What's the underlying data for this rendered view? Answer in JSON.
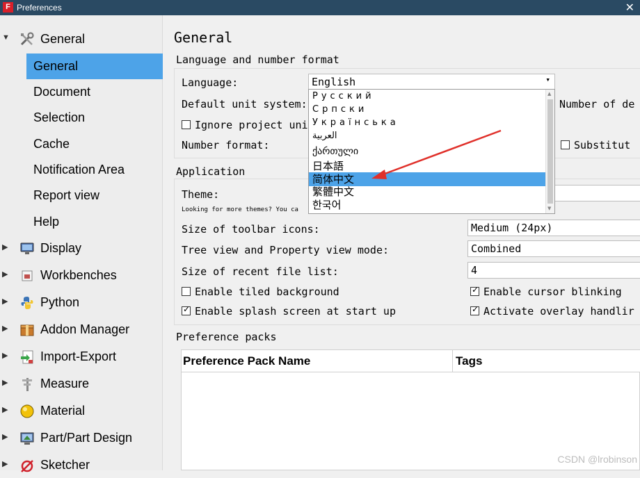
{
  "window": {
    "title": "Preferences",
    "close": "✕"
  },
  "sidebar": {
    "items": [
      {
        "label": "General",
        "expanded": true,
        "icon": "wrench-screwdriver-icon"
      },
      {
        "label": "General",
        "child": true,
        "selected": true
      },
      {
        "label": "Document",
        "child": true
      },
      {
        "label": "Selection",
        "child": true
      },
      {
        "label": "Cache",
        "child": true
      },
      {
        "label": "Notification Area",
        "child": true
      },
      {
        "label": "Report view",
        "child": true
      },
      {
        "label": "Help",
        "child": true
      },
      {
        "label": "Display",
        "icon": "monitor-icon"
      },
      {
        "label": "Workbenches",
        "icon": "workbench-icon"
      },
      {
        "label": "Python",
        "icon": "python-icon"
      },
      {
        "label": "Addon Manager",
        "icon": "addon-box-icon"
      },
      {
        "label": "Import-Export",
        "icon": "import-export-icon"
      },
      {
        "label": "Measure",
        "icon": "caliper-icon"
      },
      {
        "label": "Material",
        "icon": "material-sphere-icon"
      },
      {
        "label": "Part/Part Design",
        "icon": "part-design-icon"
      },
      {
        "label": "Sketcher",
        "icon": "sketcher-icon"
      }
    ]
  },
  "main": {
    "title": "General",
    "language_group": {
      "title": "Language and number format",
      "language_label": "Language:",
      "language_value": "English",
      "unit_label": "Default unit system:",
      "ignore_label": "Ignore project uni",
      "number_format_label": "Number format:",
      "number_of_label": "Number of de",
      "substitute_label": "Substitut"
    },
    "application_group": {
      "title": "Application",
      "theme_label": "Theme:",
      "themes_hint": "Looking for more themes? You ca",
      "toolbar_icons_label": "Size of toolbar icons:",
      "toolbar_icons_value": "Medium (24px)",
      "tree_mode_label": "Tree view and Property view mode:",
      "tree_mode_value": "Combined",
      "recent_files_label": "Size of recent file list:",
      "recent_files_value": "4",
      "tiled_bg_label": "Enable tiled background",
      "tiled_bg_checked": false,
      "cursor_blink_label": "Enable cursor blinking",
      "cursor_blink_checked": true,
      "splash_label": "Enable splash screen at start up",
      "splash_checked": true,
      "overlay_label": "Activate overlay handlir",
      "overlay_checked": true
    },
    "packs_group": {
      "title": "Preference packs",
      "columns": [
        "Preference Pack Name",
        "Tags"
      ]
    },
    "language_dropdown": {
      "options": [
        "Русский",
        "Српски",
        "Українська",
        "العربية",
        "ქართული",
        "日本語",
        "简体中文",
        "繁體中文",
        "한국어"
      ],
      "highlighted": "简体中文"
    }
  },
  "watermark": "CSDN @lrobinson",
  "colors": {
    "titlebar": "#2a4a63",
    "selection": "#4da3e8",
    "annotation_arrow": "#e0302a"
  }
}
